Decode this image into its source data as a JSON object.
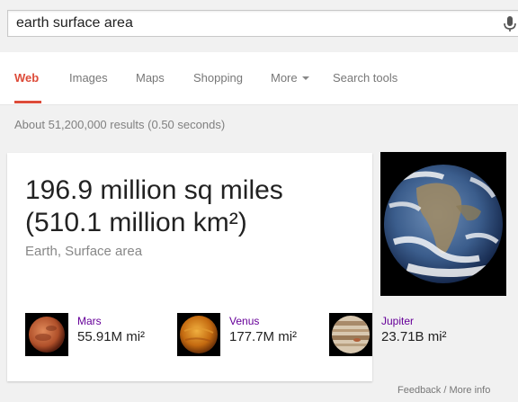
{
  "search": {
    "query": "earth surface area"
  },
  "tabs": [
    {
      "label": "Web"
    },
    {
      "label": "Images"
    },
    {
      "label": "Maps"
    },
    {
      "label": "Shopping"
    },
    {
      "label": "More"
    },
    {
      "label": "Search tools"
    }
  ],
  "results_info": "About 51,200,000 results (0.50 seconds)",
  "answer": {
    "line1": "196.9 million sq miles",
    "line2": "(510.1 million km²)",
    "subject": "Earth, Surface area"
  },
  "related": [
    {
      "name": "Mars",
      "value": "55.91M mi²"
    },
    {
      "name": "Venus",
      "value": "177.7M mi²"
    },
    {
      "name": "Jupiter",
      "value": "23.71B mi²"
    }
  ],
  "footer": {
    "feedback": "Feedback / More info"
  },
  "colors": {
    "accent": "#dd4b39",
    "link_visited": "#660099",
    "background": "#f1f1f1"
  }
}
